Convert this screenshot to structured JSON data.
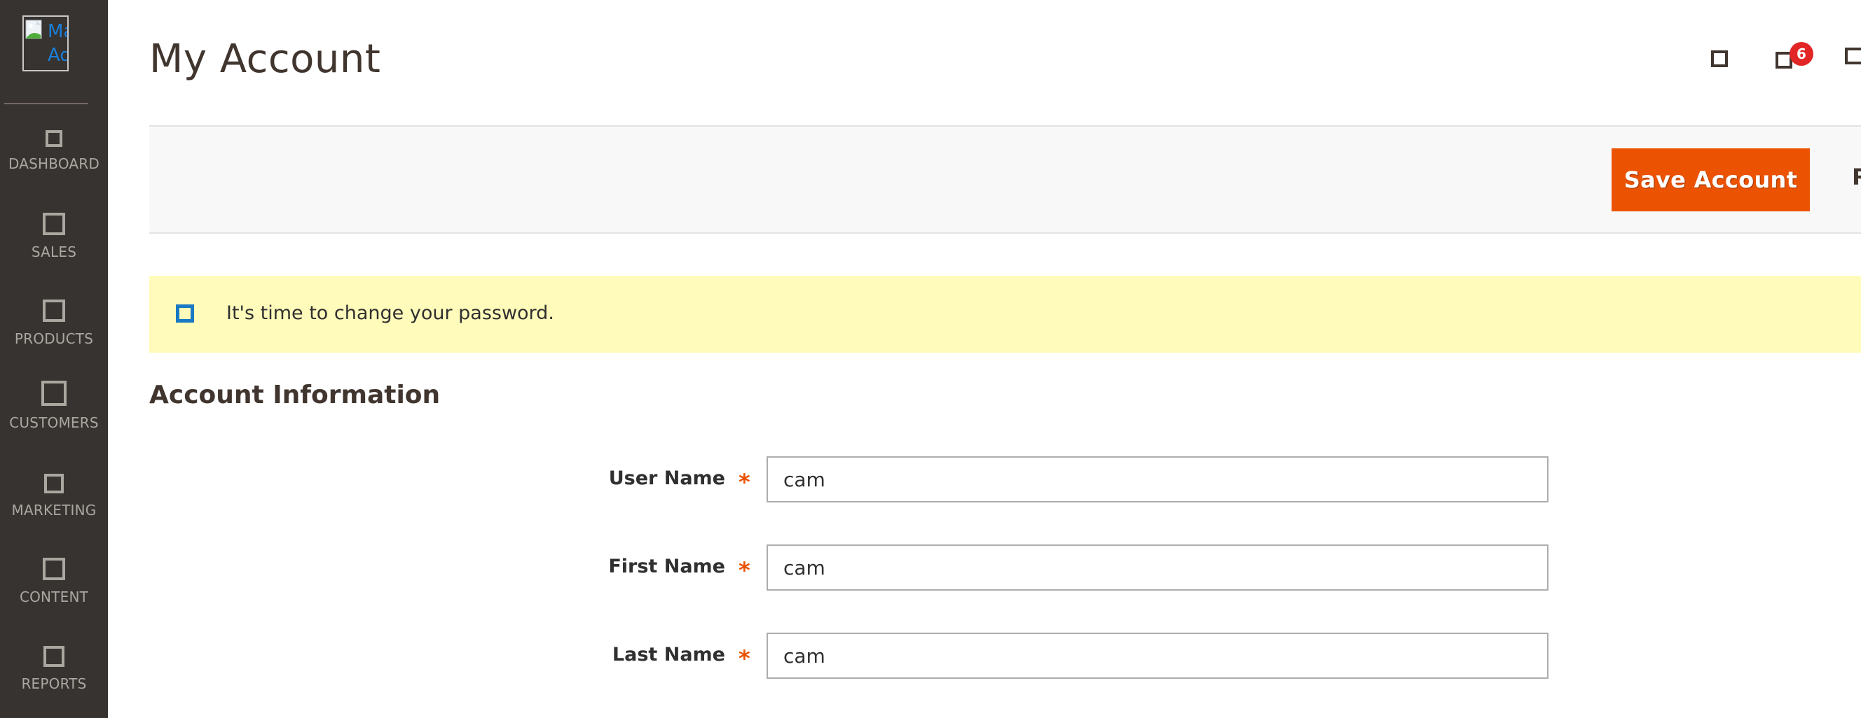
{
  "sidebar": {
    "logo_alt_line1": "Ma",
    "logo_alt_line2": "Ad",
    "items": [
      {
        "label": "DASHBOARD",
        "icon": "dashboard-icon"
      },
      {
        "label": "SALES",
        "icon": "sales-icon"
      },
      {
        "label": "PRODUCTS",
        "icon": "products-icon"
      },
      {
        "label": "CUSTOMERS",
        "icon": "customers-icon"
      },
      {
        "label": "MARKETING",
        "icon": "marketing-icon"
      },
      {
        "label": "CONTENT",
        "icon": "content-icon"
      },
      {
        "label": "REPORTS",
        "icon": "reports-icon"
      }
    ]
  },
  "header": {
    "title": "My Account",
    "notifications_count": "6"
  },
  "actions": {
    "save_label": "Save Account",
    "reset_label": "Reset"
  },
  "message": {
    "text": "It's time to change your password."
  },
  "section": {
    "title": "Account Information",
    "fields": [
      {
        "label": "User Name",
        "value": "cam",
        "required": "*"
      },
      {
        "label": "First Name",
        "value": "cam",
        "required": "*"
      },
      {
        "label": "Last Name",
        "value": "cam",
        "required": "*"
      }
    ]
  },
  "colors": {
    "sidebar_bg": "#373330",
    "accent": "#eb5202",
    "badge": "#e22626",
    "message_bg": "#fffbbb",
    "message_icon": "#1979c3"
  }
}
